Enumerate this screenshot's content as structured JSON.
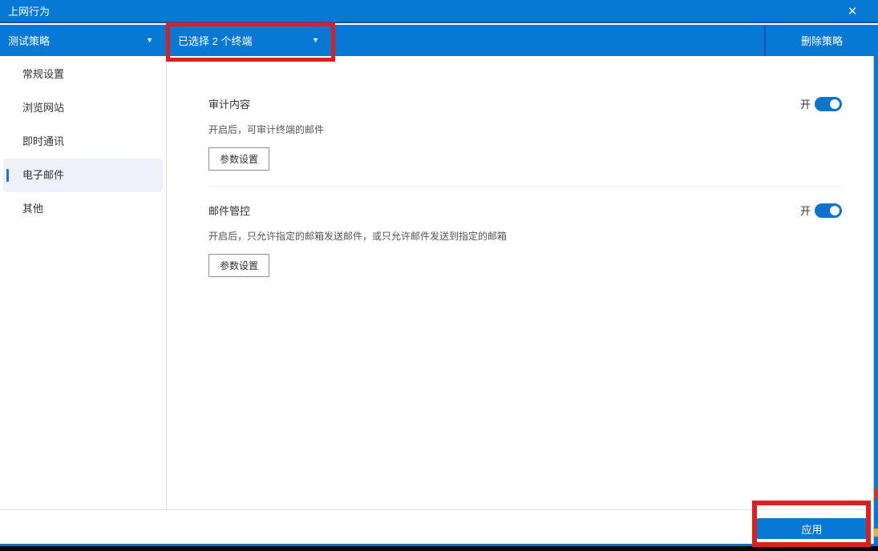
{
  "window": {
    "title": "上网行为"
  },
  "icons": {
    "close": "×",
    "caret_down": "▼"
  },
  "toolbar": {
    "policy_dropdown": {
      "label": "测试策略"
    },
    "device_dropdown": {
      "label": "已选择 2 个终端"
    },
    "delete_button": "删除策略"
  },
  "sidebar": {
    "items": [
      {
        "label": "常规设置",
        "selected": false
      },
      {
        "label": "浏览网站",
        "selected": false
      },
      {
        "label": "即时通讯",
        "selected": false
      },
      {
        "label": "电子邮件",
        "selected": true
      },
      {
        "label": "其他",
        "selected": false
      }
    ]
  },
  "main": {
    "sections": [
      {
        "title": "审计内容",
        "description": "开启后，可审计终端的邮件",
        "toggle": {
          "state_label": "开",
          "on": true
        },
        "button": "参数设置"
      },
      {
        "title": "邮件管控",
        "description": "开启后，只允许指定的邮箱发送邮件，或只允许邮件发送到指定的邮箱",
        "toggle": {
          "state_label": "开",
          "on": true
        },
        "button": "参数设置"
      }
    ]
  },
  "footer": {
    "apply_button": "应用"
  },
  "annotations": {
    "highlight_color": "#dd1f1f",
    "highlighted_targets": [
      "device-dropdown",
      "apply-button"
    ]
  },
  "colors": {
    "accent_blue": "#0778d4",
    "toolbar_divider_blue": "#1156a0",
    "selected_item_bg": "#eef1f7",
    "annotation_red": "#dd1f1f",
    "toggle_on_blue": "#0c74cc"
  }
}
